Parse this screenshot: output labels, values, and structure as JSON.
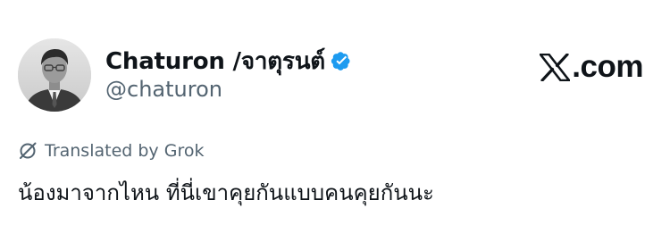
{
  "author": {
    "display_name": "Chaturon /จาตุรนต์",
    "handle": "@chaturon",
    "verified_icon": "verified-badge-icon",
    "verified_color": "#1d9bf0"
  },
  "brand": {
    "logo_icon": "x-logo-icon",
    "domain_suffix": ".com"
  },
  "translation": {
    "icon": "grok-icon",
    "label": "Translated by Grok"
  },
  "tweet": {
    "text": "น้องมาจากไหน ที่นี่เขาคุยกันแบบคนคุยกันนะ"
  },
  "colors": {
    "primary_text": "#0f1419",
    "secondary_text": "#536471",
    "accent": "#1d9bf0",
    "background": "#ffffff"
  }
}
